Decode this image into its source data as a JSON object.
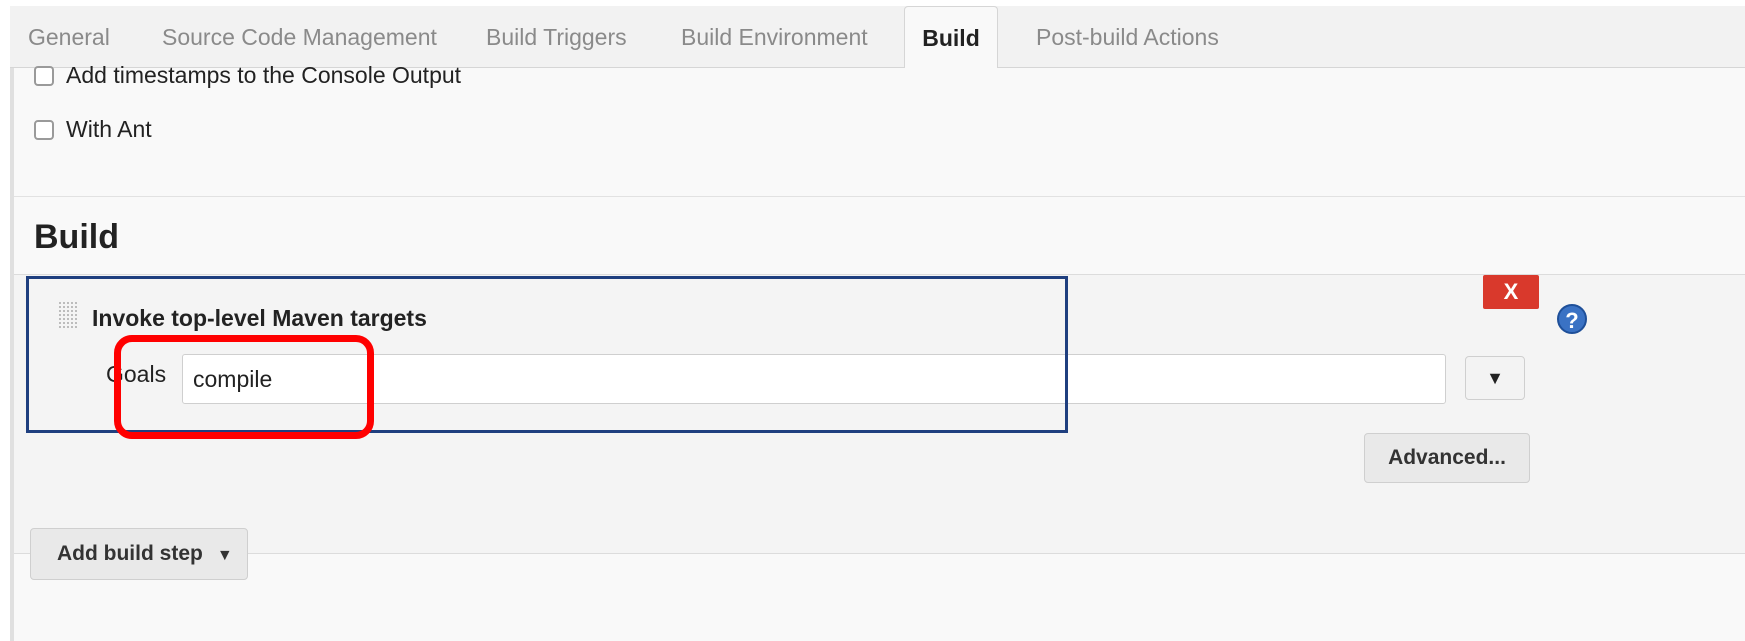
{
  "tabs": [
    {
      "label": "General"
    },
    {
      "label": "Source Code Management"
    },
    {
      "label": "Build Triggers"
    },
    {
      "label": "Build Environment"
    },
    {
      "label": "Build",
      "active": true
    },
    {
      "label": "Post-build Actions"
    }
  ],
  "build_environment": {
    "options": [
      {
        "label": "Add timestamps to the Console Output",
        "checked": false
      },
      {
        "label": "With Ant",
        "checked": false
      }
    ]
  },
  "build": {
    "heading": "Build",
    "step": {
      "title": "Invoke top-level Maven targets",
      "delete_label": "X",
      "help_label": "?",
      "goals_label": "Goals",
      "goals_value": "compile",
      "expand_label": "▼",
      "advanced_label": "Advanced..."
    },
    "add_step_label": "Add build step",
    "add_step_caret": "▼"
  },
  "colors": {
    "delete_button": "#d9392c",
    "annotation_blue": "#1f3f7f",
    "annotation_red": "#ff0000"
  }
}
